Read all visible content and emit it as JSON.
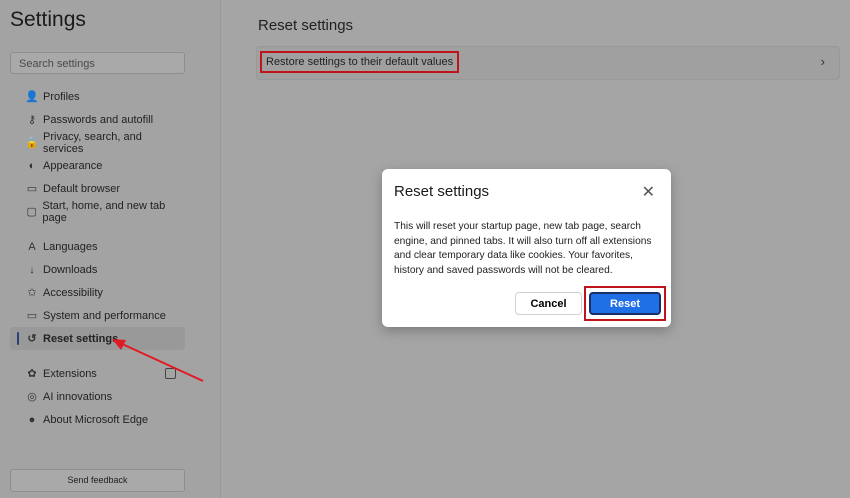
{
  "sidebar": {
    "title": "Settings",
    "search_placeholder": "Search settings",
    "items": [
      {
        "label": "Profiles",
        "icon": "👤"
      },
      {
        "label": "Passwords and autofill",
        "icon": "⚷"
      },
      {
        "label": "Privacy, search, and services",
        "icon": "🔒"
      },
      {
        "label": "Appearance",
        "icon": "◐"
      },
      {
        "label": "Default browser",
        "icon": "▭"
      },
      {
        "label": "Start, home, and new tab page",
        "icon": "▢"
      },
      {
        "label": "Languages",
        "icon": "A"
      },
      {
        "label": "Downloads",
        "icon": "↓"
      },
      {
        "label": "Accessibility",
        "icon": "✩"
      },
      {
        "label": "System and performance",
        "icon": "▭"
      },
      {
        "label": "Reset settings",
        "icon": "↺"
      },
      {
        "label": "Extensions",
        "icon": "✿"
      },
      {
        "label": "AI innovations",
        "icon": "◎"
      },
      {
        "label": "About Microsoft Edge",
        "icon": "●"
      }
    ],
    "feedback": "Send feedback"
  },
  "main": {
    "title": "Reset settings",
    "restore_label": "Restore settings to their default values",
    "chevron": "›"
  },
  "dialog": {
    "title": "Reset settings",
    "close": "✕",
    "body": "This will reset your startup page, new tab page, search engine, and pinned tabs. It will also turn off all extensions and clear temporary data like cookies. Your favorites, history and saved passwords will not be cleared.",
    "cancel": "Cancel",
    "reset": "Reset"
  },
  "colors": {
    "accent": "#1f6fe6",
    "highlight": "#c0141b"
  }
}
